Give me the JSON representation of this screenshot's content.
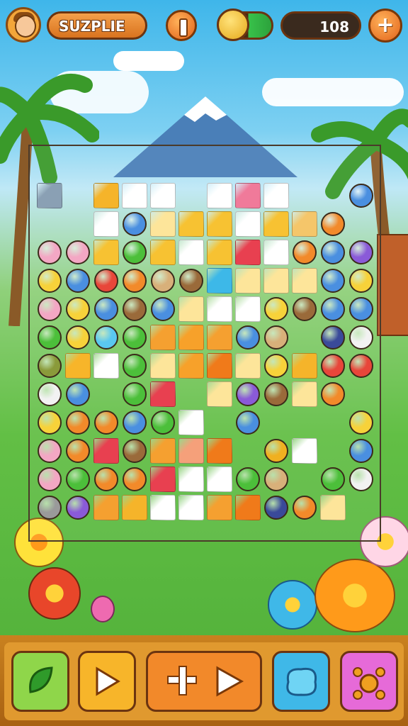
{
  "header": {
    "level_title": "SUZPLIE",
    "score": "108",
    "add_symbol": "+",
    "pause_icon": "pause-icon",
    "coin_icon": "coin-icon"
  },
  "toolbar": {
    "items": [
      {
        "name": "leaf-hint-button",
        "icon": "leaf-icon",
        "color": "#8fd64a"
      },
      {
        "name": "play-button",
        "icon": "play-icon",
        "color": "#f7b52a"
      },
      {
        "name": "step-play-button",
        "icon": "step-play-icon",
        "color": "#f2892a"
      },
      {
        "name": "blob-power-button",
        "icon": "blob-icon",
        "color": "#3fb8e8"
      },
      {
        "name": "bomb-power-button",
        "icon": "bomb-icon",
        "color": "#e66ad8"
      }
    ]
  },
  "board": {
    "tiles": [
      [
        "#8aa0b4",
        "",
        "#f5b42a",
        "#ffffff",
        "#ffffff",
        "",
        "#ffffff",
        "#f07a9a",
        "#ffffff",
        "",
        "",
        "monster-blue"
      ],
      [
        "",
        "",
        "#ffffff",
        "monster-blue",
        "#fde59a",
        "#f7c232",
        "#f7c232",
        "#ffffff",
        "#f7c232",
        "#f5c66a",
        "scroll-orange",
        ""
      ],
      [
        "pig-pink",
        "gem-pink",
        "#f7c232",
        "tree-green",
        "#f7c232",
        "#ffffff",
        "#f7c232",
        "#e84050",
        "#ffffff",
        "pencil-orange",
        "ice-blue",
        "monster-purple"
      ],
      [
        "chick-yellow",
        "box-blue",
        "hammer-red",
        "bird-orange",
        "owl-tan",
        "owl-brown",
        "#3db8e8",
        "#fde59a",
        "#fde59a",
        "#fde59a",
        "bulb-blue",
        "banana-yellow"
      ],
      [
        "pig-pink",
        "cat-yellow",
        "cat-blue",
        "log-brown",
        "cat-blue",
        "#fde59a",
        "#ffffff",
        "#ffffff",
        "cat-yellow",
        "chest-brown",
        "boot-blue",
        "robot-blue"
      ],
      [
        "frog-green",
        "cat-yellow",
        "ice-cube",
        "frog-green",
        "#f5a030",
        "#f7a12a",
        "#f5a030",
        "pencil-blue",
        "scroll-tan",
        "",
        "box-navy",
        "sheep-white"
      ],
      [
        "owl-olive",
        "#f7b52a",
        "#ffffff",
        "cactus-green",
        "#fde59a",
        "#f7a12a",
        "#f07a1a",
        "#fde59a",
        "pencil-yellow",
        "#f5b42a",
        "bowl-red",
        "monster-red"
      ],
      [
        "ghost-white",
        "gem-blue",
        "",
        "apple-green",
        "#e84050",
        "",
        "#fde59a",
        "bat-purple",
        "owl-brown",
        "#fde59a",
        "flower-orange",
        ""
      ],
      [
        "bear-yellow",
        "bread-orange",
        "bear-orange",
        "bird-blue",
        "dino-green",
        "#ffffff",
        "",
        "bag-blue",
        "",
        "",
        "",
        "dog-yellow"
      ],
      [
        "pig-pink",
        "fish-orange",
        "#e84050",
        "hedgehog-brown",
        "#f5a030",
        "#f5a07a",
        "#f07a1a",
        "",
        "gem-gold",
        "#ffffff",
        "",
        "bird-blue"
      ],
      [
        "egg-pink",
        "frog-green",
        "fire-orange",
        "cat-orange",
        "#e84050",
        "#ffffff",
        "#ffffff",
        "frog-green",
        "hammer-tan",
        "",
        "frog-green",
        "sheep-white"
      ],
      [
        "hedgehog-gray",
        "cat-purple",
        "#f5a030",
        "#f5b42a",
        "#ffffff",
        "#ffffff",
        "#f5a030",
        "#f07a1a",
        "box-navy",
        "pencil-orange",
        "#fde59a",
        ""
      ]
    ]
  }
}
